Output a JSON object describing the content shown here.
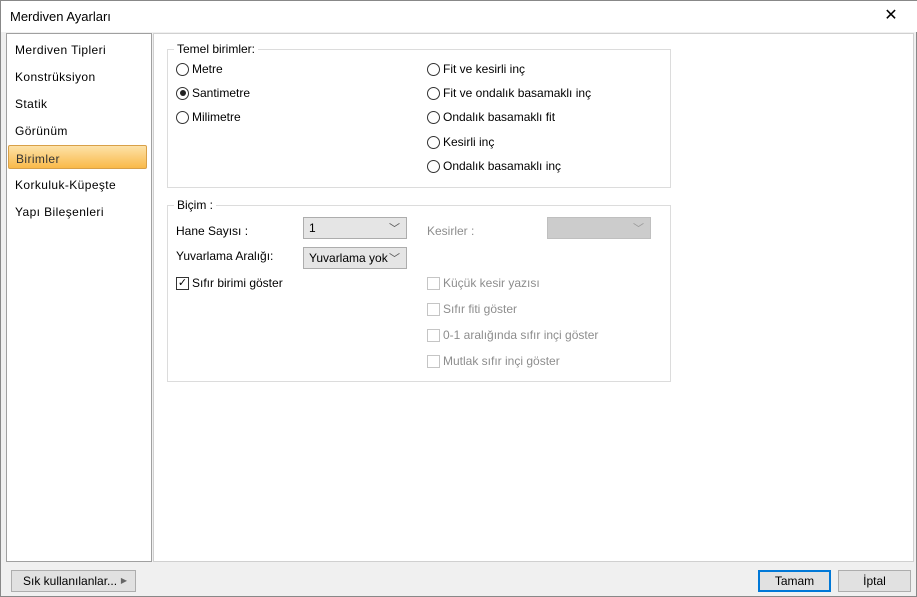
{
  "window": {
    "title": "Merdiven Ayarları",
    "close_icon": "✕"
  },
  "sidebar": {
    "items": [
      {
        "label": "Merdiven Tipleri"
      },
      {
        "label": "Konstrüksiyon"
      },
      {
        "label": "Statik"
      },
      {
        "label": "Görünüm"
      },
      {
        "label": "Birimler",
        "selected": true
      },
      {
        "label": "Korkuluk-Küpeşte"
      },
      {
        "label": "Yapı Bileşenleri"
      }
    ]
  },
  "units": {
    "legend": "Temel birimler:",
    "metric": [
      {
        "label": "Metre",
        "checked": false
      },
      {
        "label": "Santimetre",
        "checked": true
      },
      {
        "label": "Milimetre",
        "checked": false
      }
    ],
    "imperial": [
      {
        "label": "Fit ve kesirli inç"
      },
      {
        "label": "Fit ve ondalık basamaklı inç"
      },
      {
        "label": "Ondalık basamaklı fit"
      },
      {
        "label": "Kesirli inç"
      },
      {
        "label": "Ondalık basamaklı inç"
      }
    ]
  },
  "format": {
    "legend": "Biçim :",
    "digits_label": "Hane Sayısı :",
    "digits_value": "1",
    "rounding_label": "Yuvarlama Aralığı:",
    "rounding_value": "Yuvarlama yok",
    "fractions_label": "Kesirler :",
    "fractions_value": "",
    "show_zero_unit": "Sıfır birimi göster",
    "disabled_checks": [
      "Küçük kesir yazısı",
      "Sıfır fiti göster",
      "0-1 aralığında sıfır inçi göster",
      "Mutlak sıfır inçi göster"
    ]
  },
  "footer": {
    "favorites": "Sık kullanılanlar...",
    "ok": "Tamam",
    "cancel": "İptal"
  }
}
